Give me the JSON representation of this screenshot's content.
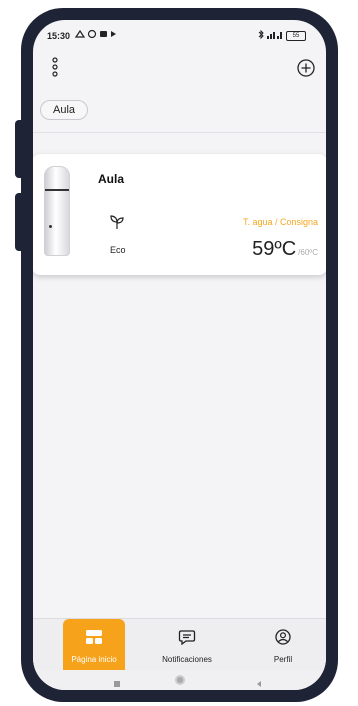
{
  "status_bar": {
    "time": "15:30",
    "battery": "55"
  },
  "home_filters": [
    {
      "label": "Aula"
    }
  ],
  "devices": [
    {
      "name": "Aula",
      "mode_label": "Eco",
      "mode_icon": "leaf-icon",
      "temp_caption": "T. agua / Consigna",
      "water_temp": "59ºC",
      "setpoint_temp": "/60ºC"
    }
  ],
  "bottom_nav": [
    {
      "label": "Página inicio",
      "icon": "home-grid-icon",
      "active": true
    },
    {
      "label": "Notificaciones",
      "icon": "message-icon",
      "active": false
    },
    {
      "label": "Perfil",
      "icon": "profile-icon",
      "active": false
    }
  ],
  "colors": {
    "accent": "#f6a21a",
    "temp_caption": "#f5a623",
    "frame": "#1f2336"
  }
}
